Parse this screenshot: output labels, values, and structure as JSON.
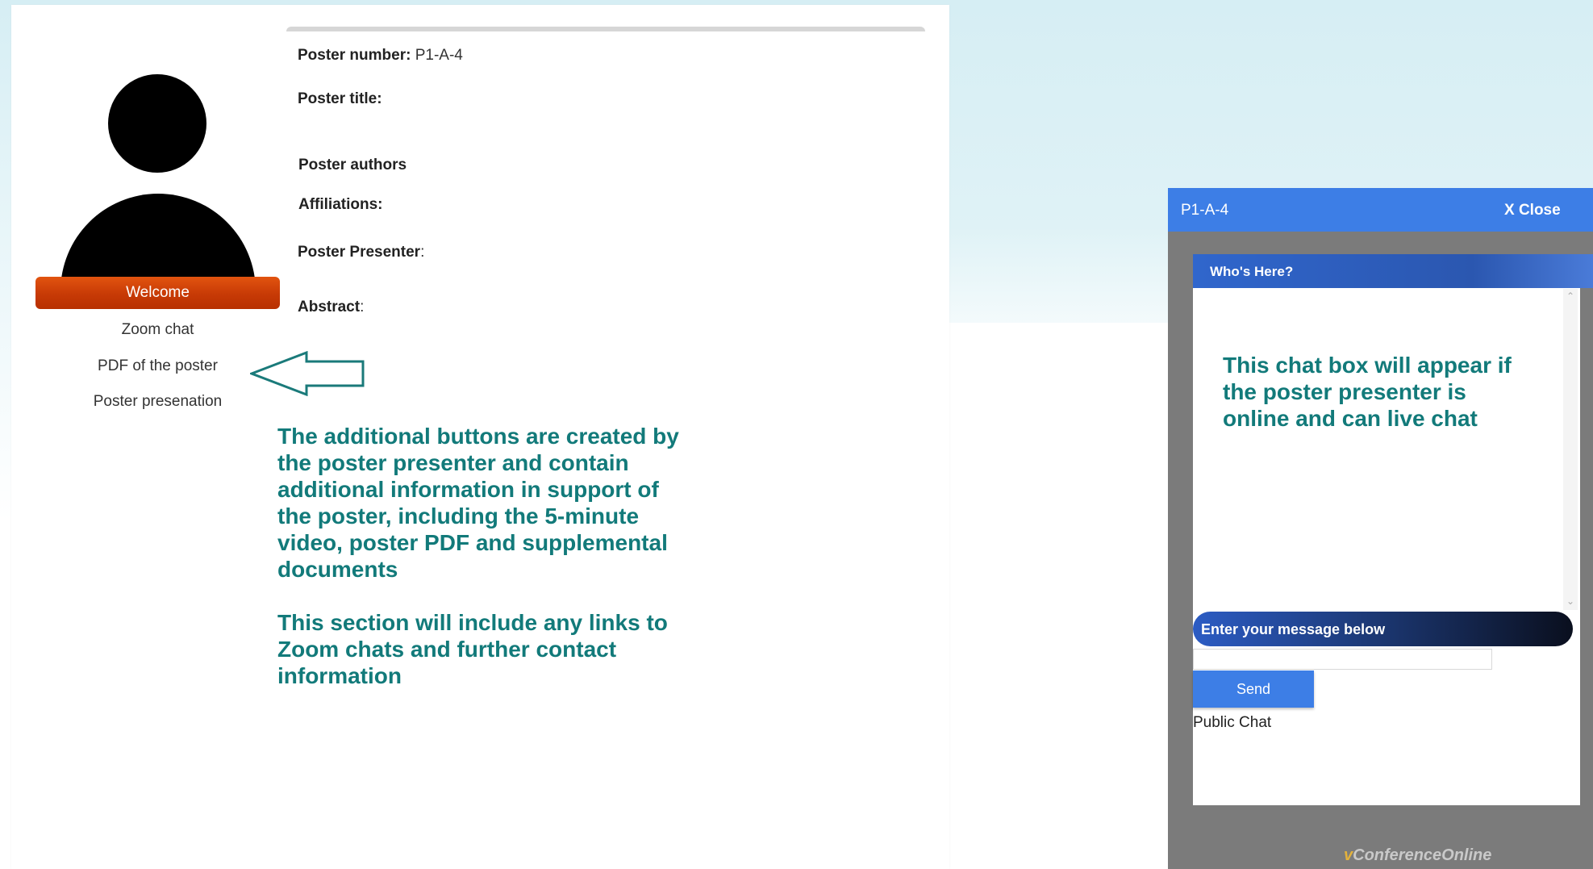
{
  "poster": {
    "number_label": "Poster number:",
    "number_value": "P1-A-4",
    "title_label": "Poster title:",
    "authors_label": "Poster authors",
    "affiliations_label": "Affiliations:",
    "presenter_label": "Poster Presenter",
    "presenter_colon": ":",
    "abstract_label": "Abstract",
    "abstract_colon": ":"
  },
  "sidebar": {
    "welcome_label": "Welcome",
    "links": [
      "Zoom chat",
      "PDF of the poster",
      "Poster presenation"
    ]
  },
  "annotations": {
    "buttons_note": [
      "The additional buttons are created by",
      "the poster presenter and contain",
      "additional information in support of",
      "the poster, including the 5-minute",
      "video, poster PDF and supplemental",
      "documents"
    ],
    "links_note": [
      "This section will include any links to",
      "Zoom chats and further contact",
      "information"
    ],
    "chat_note": [
      "This chat box will appear if",
      "the poster presenter is",
      "online and can live chat"
    ]
  },
  "chat": {
    "title": "P1-A-4",
    "close_label": "X Close",
    "whos_here": "Who's Here?",
    "message_prompt": "Enter your message below",
    "input_value": "",
    "send_label": "Send",
    "public_chat_label": "Public Chat"
  },
  "brand": {
    "prefix": "v",
    "name": "ConferenceOnline"
  },
  "colors": {
    "accent_blue": "#3d7ee6",
    "welcome_orange": "#d04606",
    "annotation_teal": "#127a7a"
  }
}
